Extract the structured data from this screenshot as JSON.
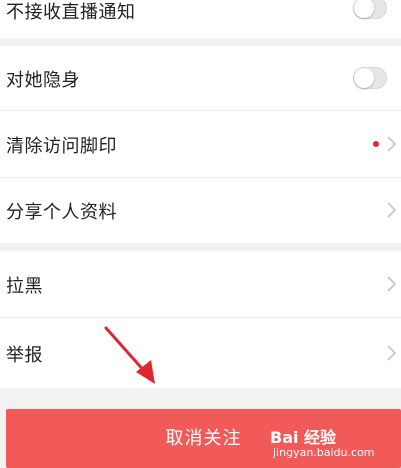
{
  "settings": {
    "items": [
      {
        "label": "不接收直播通知",
        "control": "toggle",
        "on": false
      },
      {
        "label": "对她隐身",
        "control": "toggle",
        "on": false
      },
      {
        "label": "清除访问脚印",
        "control": "chevron",
        "has_dot": true
      },
      {
        "label": "分享个人资料",
        "control": "chevron"
      },
      {
        "label": "拉黑",
        "control": "chevron"
      },
      {
        "label": "举报",
        "control": "chevron"
      }
    ]
  },
  "footer": {
    "unfollow_label": "取消关注"
  },
  "watermark": {
    "brand": "Bai 经验",
    "url": "jingyan.baidu.com"
  },
  "colors": {
    "accent": "#f25a5a",
    "dot": "#e0262f",
    "background": "#f2f2f2"
  },
  "icons": {
    "chevron": "chevron-right-icon",
    "arrow": "red-pointer-arrow"
  }
}
